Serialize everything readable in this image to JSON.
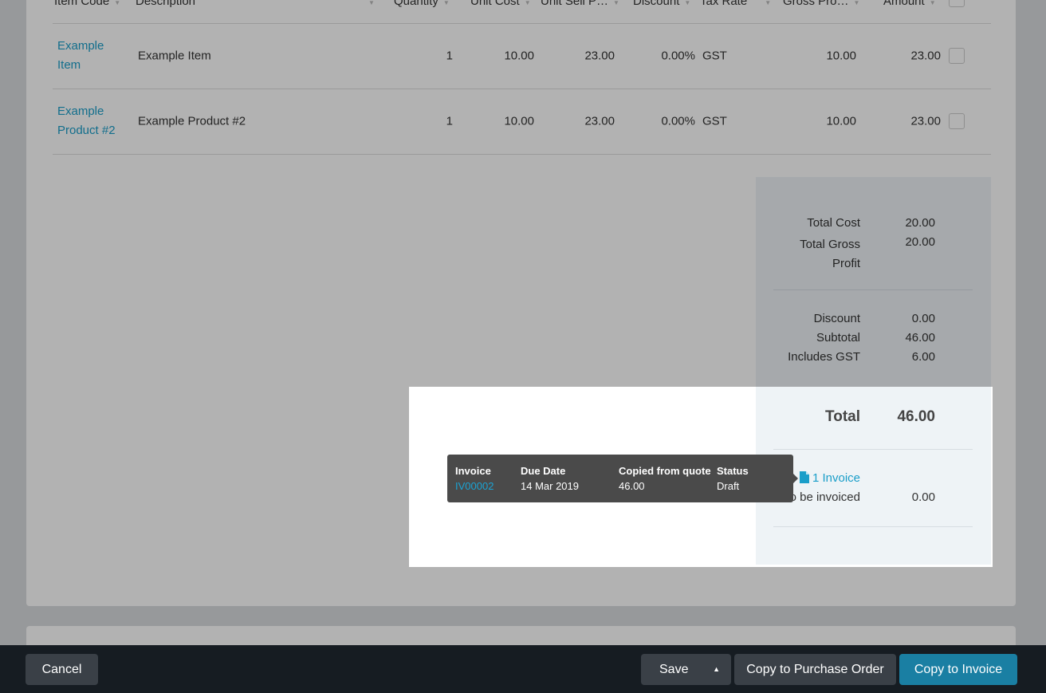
{
  "table": {
    "headers": {
      "item_code": "Item Code",
      "description": "Description",
      "quantity": "Quantity",
      "unit_cost": "Unit Cost",
      "unit_sell": "Unit Sell P…",
      "discount": "Discount",
      "tax_rate": "Tax Rate",
      "gross_profit": "Gross Pro…",
      "amount": "Amount"
    },
    "rows": [
      {
        "item_code": "Example Item",
        "description": "Example Item",
        "quantity": "1",
        "unit_cost": "10.00",
        "unit_sell": "23.00",
        "discount": "0.00%",
        "tax_rate": "GST",
        "gross_profit": "10.00",
        "amount": "23.00"
      },
      {
        "item_code": "Example Product #2",
        "description": "Example Product #2",
        "quantity": "1",
        "unit_cost": "10.00",
        "unit_sell": "23.00",
        "discount": "0.00%",
        "tax_rate": "GST",
        "gross_profit": "10.00",
        "amount": "23.00"
      }
    ]
  },
  "totals": {
    "total_cost_label": "Total Cost",
    "total_cost": "20.00",
    "total_gross_profit_label": "Total Gross Profit",
    "total_gross_profit": "20.00",
    "discount_label": "Discount",
    "discount": "0.00",
    "subtotal_label": "Subtotal",
    "subtotal": "46.00",
    "includes_gst_label": "Includes GST",
    "includes_gst": "6.00",
    "total_label": "Total",
    "total": "46.00",
    "invoice_link": "1 Invoice",
    "to_be_invoiced_label": "To be invoiced",
    "to_be_invoiced": "0.00"
  },
  "tooltip": {
    "headers": {
      "invoice": "Invoice",
      "due_date": "Due Date",
      "copied": "Copied from quote",
      "status": "Status"
    },
    "values": {
      "invoice": "IV00002",
      "due_date": "14 Mar 2019",
      "copied": "46.00",
      "status": "Draft"
    }
  },
  "footer": {
    "cancel": "Cancel",
    "save": "Save",
    "copy_po": "Copy to Purchase Order",
    "copy_invoice": "Copy to Invoice"
  },
  "colors": {
    "link": "#1a9ec9",
    "primary_button": "#1a7fa3",
    "footer_bg": "#161c22"
  }
}
